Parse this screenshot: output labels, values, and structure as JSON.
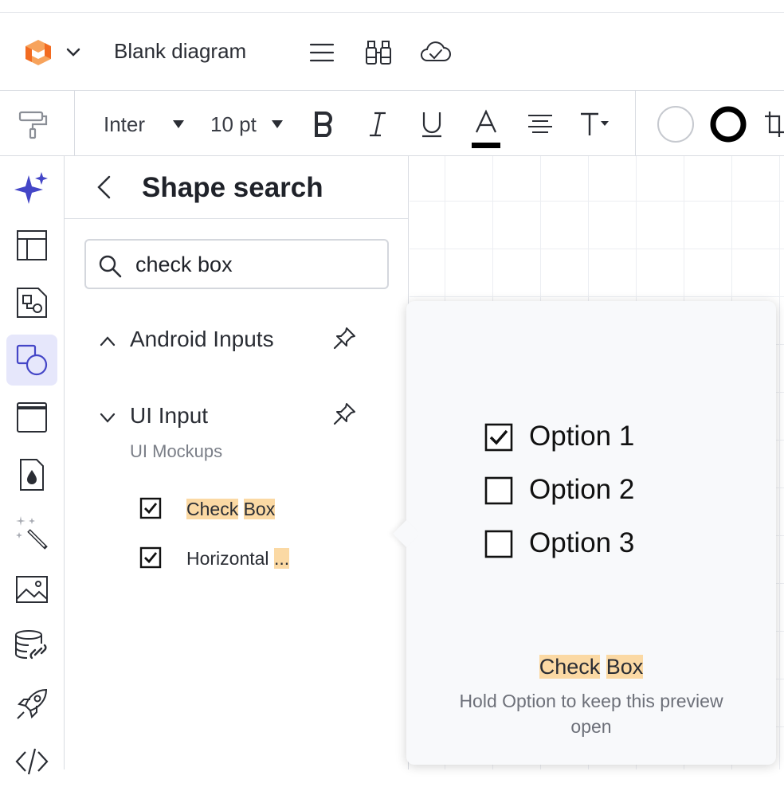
{
  "header": {
    "doc_title": "Blank diagram",
    "icons": [
      "lucid-logo",
      "chevron-down-icon",
      "menu-icon",
      "binoculars-icon",
      "cloud-check-icon"
    ]
  },
  "toolbar": {
    "font_family": "Inter",
    "font_size": "10 pt",
    "text_color": "#000000",
    "icons": [
      "paint-roller-icon",
      "bold-icon",
      "italic-icon",
      "underline-icon",
      "text-color-icon",
      "align-center-icon",
      "text-options-icon",
      "fill-color-icon",
      "line-color-icon",
      "crop-icon"
    ]
  },
  "rail": {
    "active": "shapes",
    "icons": [
      "ai-sparkle-icon",
      "templates-icon",
      "diagram-icon",
      "shapes-icon",
      "frame-icon",
      "ink-drop-icon",
      "magic-wand-icon",
      "image-icon",
      "data-link-icon",
      "rocket-icon",
      "code-icon"
    ]
  },
  "panel": {
    "title": "Shape search",
    "search_value": "check box",
    "groups": [
      {
        "label": "Android Inputs",
        "expanded": false
      },
      {
        "label": "UI Input",
        "expanded": true,
        "sublabel": "UI Mockups"
      }
    ],
    "shapes": [
      {
        "label_a": "Check",
        "label_sep": " ",
        "label_b": "Box"
      },
      {
        "label_a": "Horizontal ",
        "label_b": "..."
      }
    ]
  },
  "preview": {
    "options": [
      {
        "label": "Option 1",
        "checked": true
      },
      {
        "label": "Option 2",
        "checked": false
      },
      {
        "label": "Option 3",
        "checked": false
      }
    ],
    "name_a": "Check",
    "name_sep": " ",
    "name_b": "Box",
    "hint": "Hold Option to keep this preview open"
  },
  "colors": {
    "accent": "#5a5fe8",
    "logo_orange": "#f26b21",
    "highlight": "#fbd9a4",
    "active_bg": "#e6e7fb"
  }
}
